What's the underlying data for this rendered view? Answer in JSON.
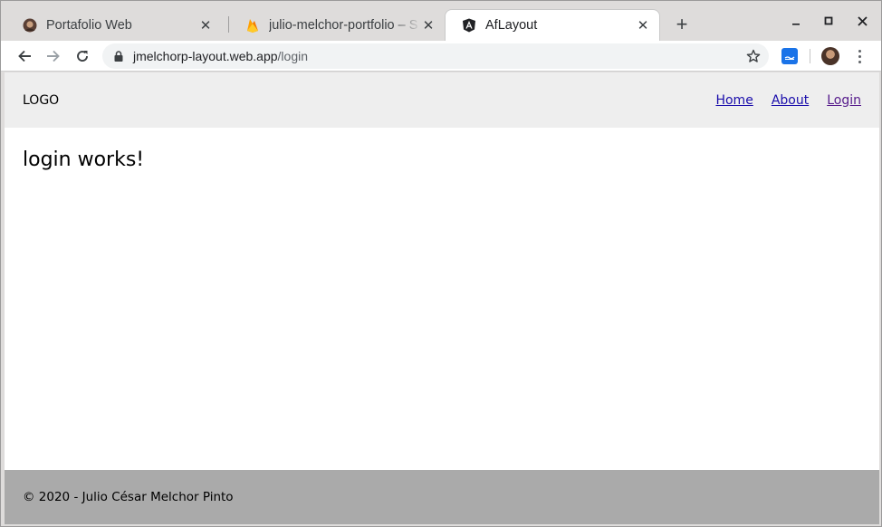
{
  "browser": {
    "tabs": [
      {
        "title": "Portafolio Web",
        "icon": "avatar-favicon-icon",
        "active": false
      },
      {
        "title": "julio-melchor-portfolio – S",
        "icon": "firebase-flame-icon",
        "active": false
      },
      {
        "title": "AfLayout",
        "icon": "angular-logo-icon",
        "active": true
      }
    ],
    "new_tab_glyph": "+",
    "close_glyph": "✕",
    "address": {
      "host": "jmelchorp-layout.web.app",
      "path": "/login"
    },
    "accent_color": "#1a73e8"
  },
  "page": {
    "header": {
      "logo": "LOGO",
      "nav": [
        {
          "label": "Home"
        },
        {
          "label": "About"
        },
        {
          "label": "Login"
        }
      ]
    },
    "heading": "login works!",
    "footer": {
      "text": "© 2020 - Julio César Melchor Pinto"
    },
    "colors": {
      "header_bg": "#eeeeee",
      "footer_bg": "#aaaaaa",
      "link": "#1a0dab",
      "link_visited": "#551a8b"
    }
  }
}
